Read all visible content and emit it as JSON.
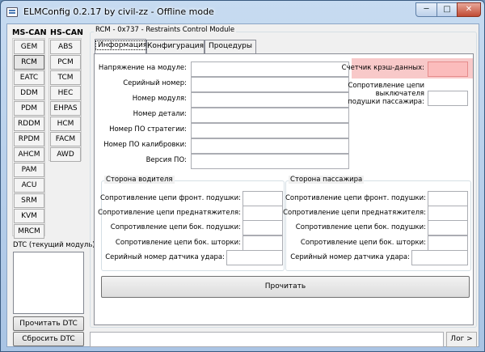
{
  "window": {
    "title": "ELMConfig 0.2.17 by civil-zz - Offline mode"
  },
  "caption_buttons": {
    "minimize": "─",
    "maximize": "□",
    "close": "✕"
  },
  "sidebar": {
    "ms_can_title": "MS-CAN",
    "hs_can_title": "HS-CAN",
    "ms_can_items": [
      {
        "label": "GEM"
      },
      {
        "label": "RCM"
      },
      {
        "label": "EATC"
      },
      {
        "label": "DDM"
      },
      {
        "label": "PDM"
      },
      {
        "label": "RDDM"
      },
      {
        "label": "RPDM"
      },
      {
        "label": "AHCM"
      },
      {
        "label": "PAM"
      },
      {
        "label": "ACU"
      },
      {
        "label": "SRM"
      },
      {
        "label": "KVM"
      },
      {
        "label": "MRCM"
      }
    ],
    "hs_can_items": [
      {
        "label": "ABS"
      },
      {
        "label": "PCM"
      },
      {
        "label": "TCM"
      },
      {
        "label": "HEC"
      },
      {
        "label": "EHPAS"
      },
      {
        "label": "HCM"
      },
      {
        "label": "FACM"
      },
      {
        "label": "AWD"
      }
    ],
    "active_item": "RCM",
    "dtc_label": "DTC (текущий модуль):",
    "read_dtc": "Прочитать DTC",
    "clear_dtc": "Сбросить DTC"
  },
  "module_group": {
    "title": "RCM - 0x737 - Restraints Control Module",
    "tabs": [
      {
        "label": "Информация"
      },
      {
        "label": "Конфигурация"
      },
      {
        "label": "Процедуры"
      }
    ],
    "active_tab": "Информация"
  },
  "info": {
    "fields": [
      {
        "label": "Напряжение на модуле:",
        "value": ""
      },
      {
        "label": "Серийный номер:",
        "value": ""
      },
      {
        "label": "Номер модуля:",
        "value": ""
      },
      {
        "label": "Номер детали:",
        "value": ""
      },
      {
        "label": "Номер ПО стратегии:",
        "value": ""
      },
      {
        "label": "Номер ПО калибровки:",
        "value": ""
      },
      {
        "label": "Версия ПО:",
        "value": ""
      }
    ],
    "crash_counter": {
      "label": "Счетчик крэш-данных:",
      "value": ""
    },
    "passenger_switch": {
      "label_lines": [
        "Сопротивление цепи",
        "выключателя",
        "подушки пассажира:"
      ],
      "value": ""
    }
  },
  "driver_side": {
    "title": "Сторона водителя",
    "fields": [
      {
        "label": "Сопротивление цепи фронт. подушки:",
        "value": ""
      },
      {
        "label": "Сопротивление цепи преднатяжителя:",
        "value": ""
      },
      {
        "label": "Сопротивление цепи бок. подушки:",
        "value": ""
      },
      {
        "label": "Сопротивление цепи бок. шторки:",
        "value": ""
      },
      {
        "label": "Серийный номер датчика удара:",
        "value": ""
      }
    ]
  },
  "passenger_side": {
    "title": "Сторона пассажира",
    "fields": [
      {
        "label": "Сопротивление цепи фронт. подушки:",
        "value": ""
      },
      {
        "label": "Сопротивление цепи преднатяжителя:",
        "value": ""
      },
      {
        "label": "Сопротивление цепи бок. подушки:",
        "value": ""
      },
      {
        "label": "Сопротивление цепи бок. шторки:",
        "value": ""
      },
      {
        "label": "Серийный номер датчика удара:",
        "value": ""
      }
    ]
  },
  "read_button": "Прочитать",
  "status_bar": {
    "text": "",
    "log_button": "Лог >"
  },
  "colors": {
    "highlight_pink": "#f8c9c9",
    "field_pink": "#fbbcbc",
    "title_bar": "#c7dbf1"
  }
}
